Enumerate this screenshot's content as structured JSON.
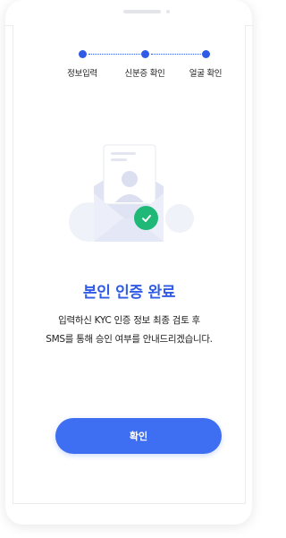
{
  "steps": [
    {
      "label": "정보입력"
    },
    {
      "label": "신분증 확인"
    },
    {
      "label": "얼굴 확인"
    }
  ],
  "result": {
    "title": "본인 인증 완료",
    "line1": "입력하신 KYC 인증 정보 최종 검토 후",
    "line2": "SMS를 통해 승인 여부를 안내드리겠습니다."
  },
  "confirm_button": {
    "label": "확인"
  },
  "colors": {
    "accent": "#2f5be6",
    "button": "#3e6ef1",
    "success": "#1fb877"
  },
  "icons": {
    "illustration": "envelope-id-card-icon",
    "check": "check-icon"
  }
}
